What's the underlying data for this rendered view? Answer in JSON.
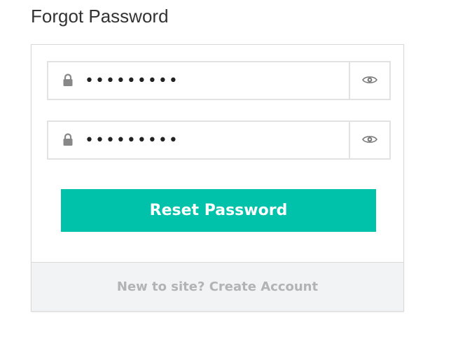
{
  "page": {
    "title": "Forgot Password"
  },
  "form": {
    "password_field": {
      "value": "•••••••••",
      "icon": "lock-icon",
      "toggle_icon": "eye-icon"
    },
    "confirm_password_field": {
      "value": "•••••••••",
      "icon": "lock-icon",
      "toggle_icon": "eye-icon"
    },
    "submit_label": "Reset Password"
  },
  "footer": {
    "link_text": "New to site? Create Account"
  },
  "colors": {
    "accent": "#00c1aa",
    "footer_bg": "#f2f3f4",
    "muted_text": "#b3b3b3",
    "border": "#e2e2e2"
  }
}
